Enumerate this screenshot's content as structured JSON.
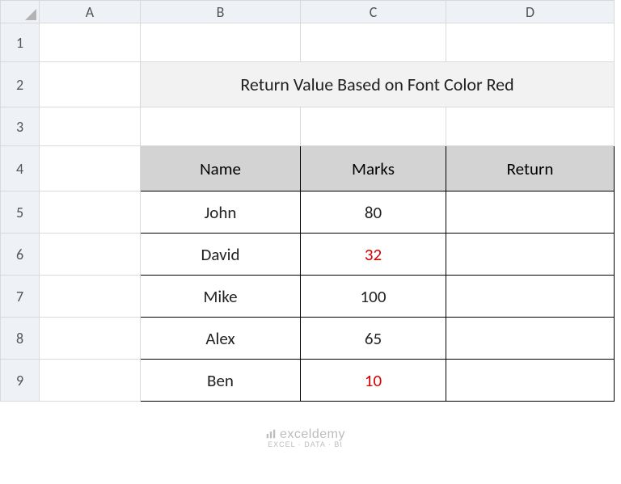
{
  "columns": [
    "A",
    "B",
    "C",
    "D"
  ],
  "row_numbers": [
    "1",
    "2",
    "3",
    "4",
    "5",
    "6",
    "7",
    "8",
    "9"
  ],
  "title": "Return Value Based on Font Color Red",
  "table": {
    "headers": {
      "name": "Name",
      "marks": "Marks",
      "return": "Return"
    },
    "rows": [
      {
        "name": "John",
        "marks": "80",
        "marks_red": false,
        "return": ""
      },
      {
        "name": "David",
        "marks": "32",
        "marks_red": true,
        "return": ""
      },
      {
        "name": "Mike",
        "marks": "100",
        "marks_red": false,
        "return": ""
      },
      {
        "name": "Alex",
        "marks": "65",
        "marks_red": false,
        "return": ""
      },
      {
        "name": "Ben",
        "marks": "10",
        "marks_red": true,
        "return": ""
      }
    ]
  },
  "watermark": {
    "text": "exceldemy",
    "sub": "EXCEL · DATA · BI"
  }
}
